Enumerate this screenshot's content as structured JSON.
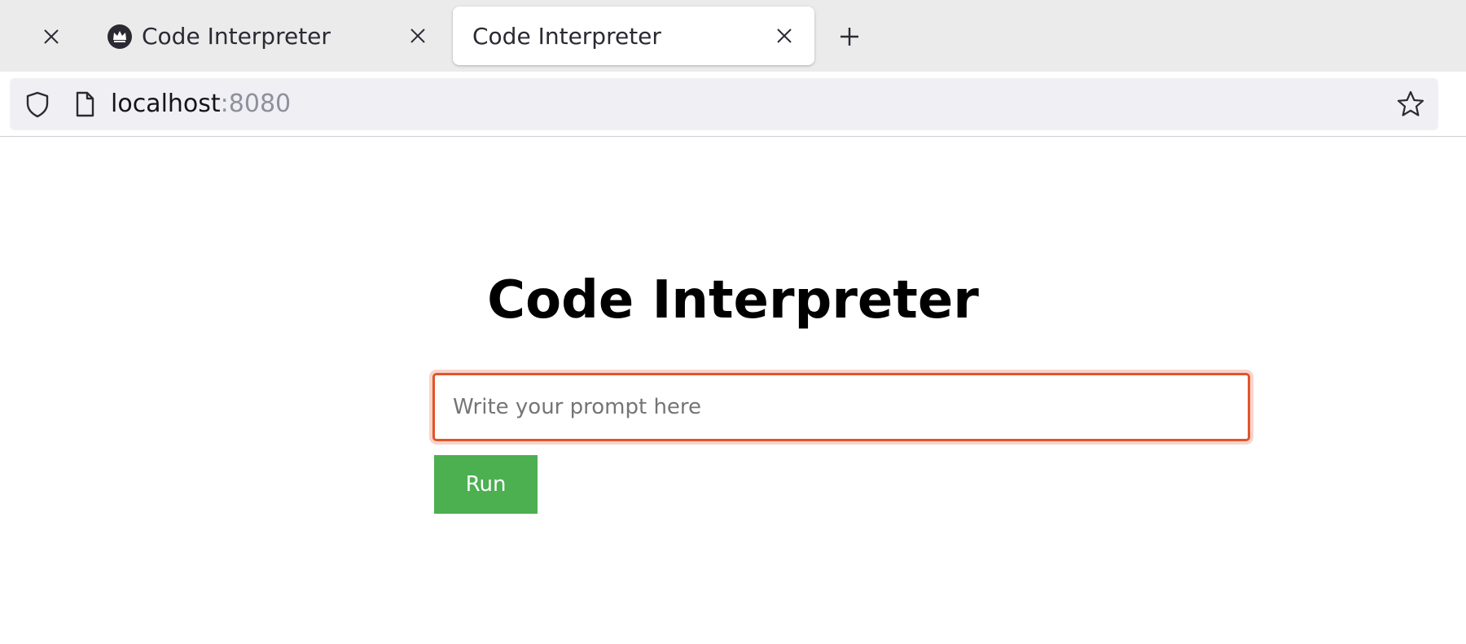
{
  "tabs": [
    {
      "title": "",
      "closable": true
    },
    {
      "title": "Code Interpreter",
      "favicon": "crown-icon",
      "active": false
    },
    {
      "title": "Code Interpreter",
      "active": true
    }
  ],
  "urlbar": {
    "host": "localhost",
    "port": ":8080"
  },
  "page": {
    "title": "Code Interpreter",
    "prompt_placeholder": "Write your prompt here",
    "prompt_value": "",
    "run_label": "Run"
  },
  "colors": {
    "accent_focus": "#e0552b",
    "run_button": "#4caf50",
    "tabstrip": "#ebebeb",
    "urlbar": "#f0f0f4"
  }
}
